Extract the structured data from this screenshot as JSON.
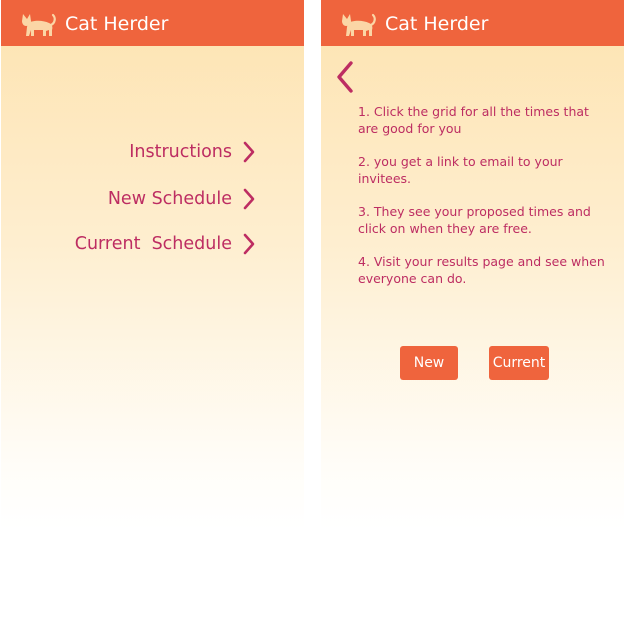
{
  "app": {
    "title": "Cat Herder",
    "logo_icon": "cat-icon"
  },
  "colors": {
    "header": "#ef643d",
    "accent_text": "#bd2d62",
    "gradient_top": "#fde3b0",
    "gradient_bottom": "#ffffff"
  },
  "menu_screen": {
    "items": [
      {
        "label": "Instructions",
        "icon": "chevron-right-icon"
      },
      {
        "label": "New Schedule",
        "icon": "chevron-right-icon"
      },
      {
        "label": "Current  Schedule",
        "icon": "chevron-right-icon"
      }
    ]
  },
  "instructions_screen": {
    "back_icon": "chevron-left-icon",
    "steps": [
      "1. Click the grid for all the times that are good for you",
      "2. you get a link to email to your invitees.",
      "3. They see your proposed times and click on when they are free.",
      "4. Visit your results page and see when everyone can do."
    ],
    "buttons": {
      "new_label": "New",
      "current_label": "Current"
    }
  }
}
